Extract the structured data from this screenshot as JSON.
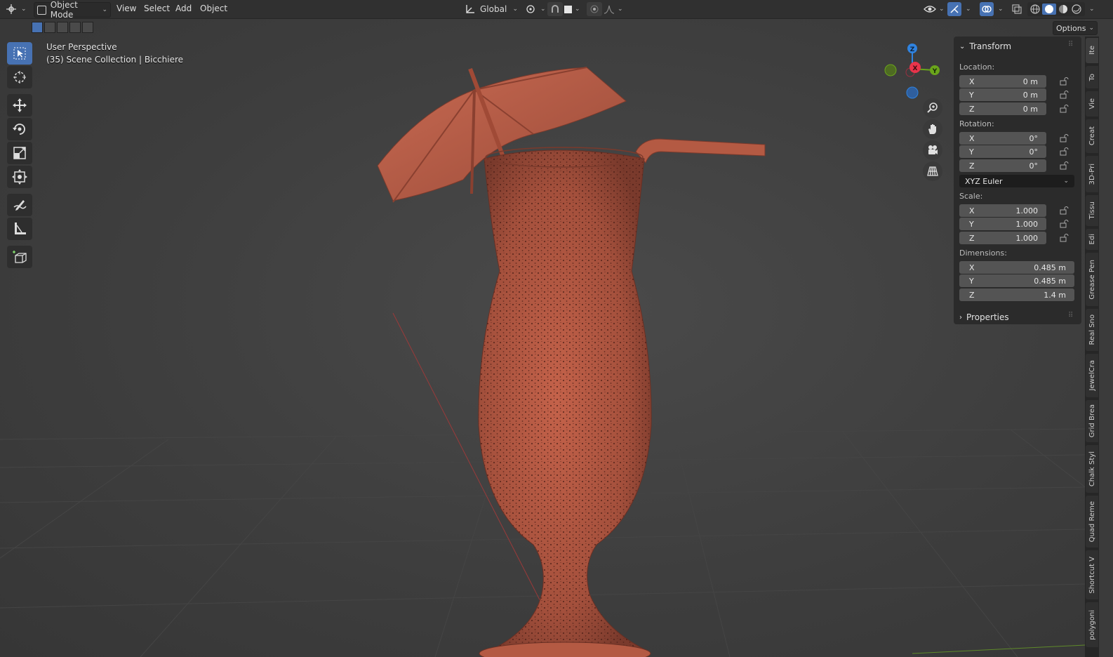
{
  "header": {
    "mode": "Object Mode",
    "menus": [
      "View",
      "Select",
      "Add",
      "Object"
    ],
    "transform_orientation": "Global",
    "options_label": "Options"
  },
  "viewport": {
    "perspective_label": "User Perspective",
    "collection_label": "(35) Scene Collection | Bicchiere",
    "gizmo_axes": {
      "z": "Z",
      "x": "X",
      "y": "Y"
    }
  },
  "toolbar": {
    "tools": [
      "select-box",
      "cursor",
      "move",
      "rotate",
      "scale",
      "transform",
      "annotate",
      "measure",
      "add-cube"
    ]
  },
  "npanel": {
    "transform_title": "Transform",
    "location_label": "Location:",
    "location": [
      {
        "axis": "X",
        "value": "0 m"
      },
      {
        "axis": "Y",
        "value": "0 m"
      },
      {
        "axis": "Z",
        "value": "0 m"
      }
    ],
    "rotation_label": "Rotation:",
    "rotation": [
      {
        "axis": "X",
        "value": "0°"
      },
      {
        "axis": "Y",
        "value": "0°"
      },
      {
        "axis": "Z",
        "value": "0°"
      }
    ],
    "rotation_mode": "XYZ Euler",
    "scale_label": "Scale:",
    "scale": [
      {
        "axis": "X",
        "value": "1.000"
      },
      {
        "axis": "Y",
        "value": "1.000"
      },
      {
        "axis": "Z",
        "value": "1.000"
      }
    ],
    "dimensions_label": "Dimensions:",
    "dimensions": [
      {
        "axis": "X",
        "value": "0.485 m"
      },
      {
        "axis": "Y",
        "value": "0.485 m"
      },
      {
        "axis": "Z",
        "value": "1.4 m"
      }
    ],
    "properties_title": "Properties"
  },
  "side_tabs": [
    "Ite",
    "To",
    "Vie",
    "Creat",
    "3D-Pri",
    "Tissu",
    "Edi",
    "Grease Pen",
    "Real Sno",
    "JewelCra",
    "Grid Brea",
    "Chalk Styl",
    "Quad Reme",
    "Shortcut V",
    "polygoni"
  ],
  "colors": {
    "accent": "#4772b3",
    "model": "#b0553f",
    "axis_x": "#e8344b",
    "axis_y": "#6aa51b",
    "axis_z": "#2f83e0"
  }
}
